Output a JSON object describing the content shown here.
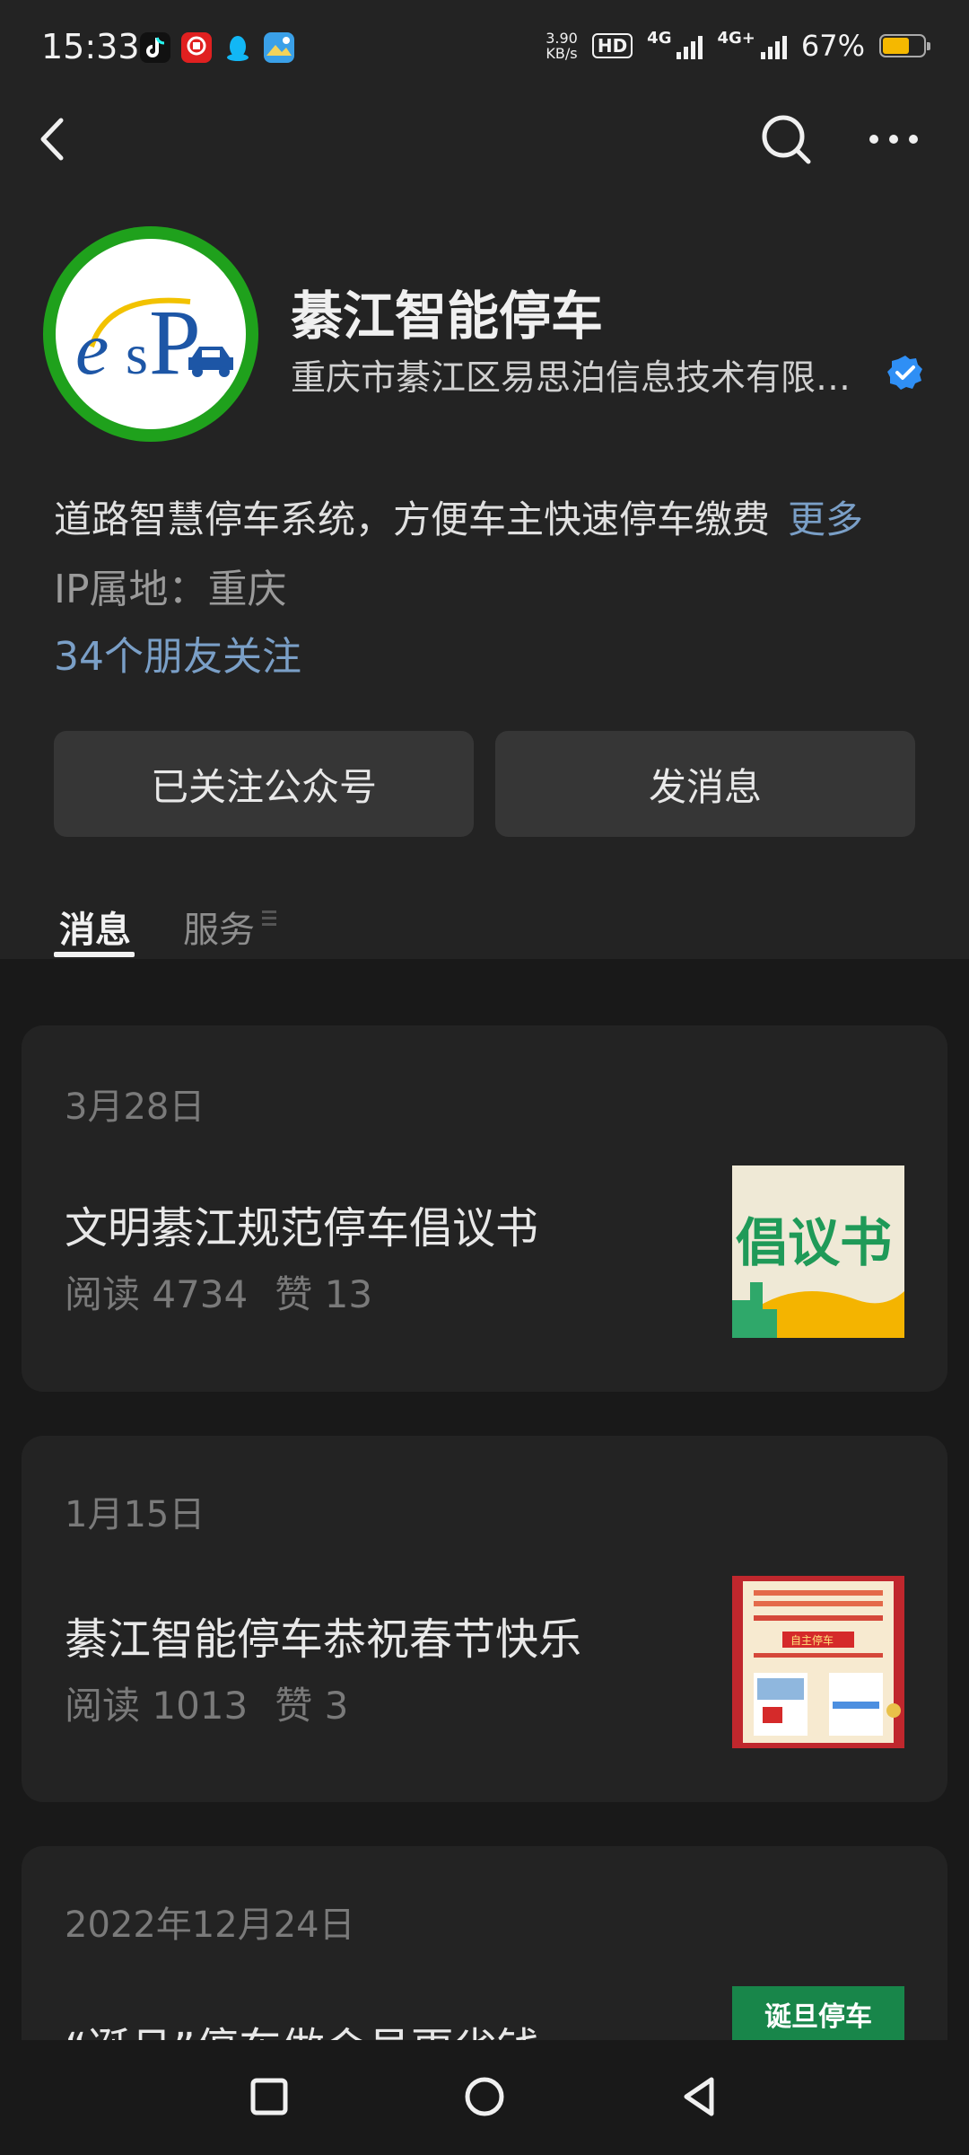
{
  "status_bar": {
    "time": "15:33",
    "net_speed_value": "3.90",
    "net_speed_unit": "KB/s",
    "hd_label": "HD",
    "net_label_1": "4G",
    "net_label_2": "4G+",
    "battery_text": "67%",
    "battery_level": 0.67
  },
  "account": {
    "name": "綦江智能停车",
    "company": "重庆市綦江区易思泊信息技术有限公司",
    "verified": true,
    "logo_letters": [
      "e",
      "s",
      "P"
    ],
    "description": "道路智慧停车系统，方便车主快速停车缴费",
    "more_label": "更多",
    "ip_location": "IP属地：重庆",
    "friends_following": "34个朋友关注"
  },
  "buttons": {
    "following_label": "已关注公众号",
    "message_label": "发消息"
  },
  "tabs": [
    {
      "label": "消息",
      "active": true
    },
    {
      "label": "服务",
      "active": false
    }
  ],
  "articles": [
    {
      "date": "3月28日",
      "title": "文明綦江规范停车倡议书",
      "reads_label": "阅读 4734",
      "likes_label": "赞 13",
      "thumb_text": "倡议书"
    },
    {
      "date": "1月15日",
      "title": "綦江智能停车恭祝春节快乐",
      "reads_label": "阅读 1013",
      "likes_label": "赞 3",
      "thumb_text": "自主停车"
    },
    {
      "date": "2022年12月24日",
      "title": "“诞旦”停车做会员更省钱",
      "reads_label": "",
      "likes_label": "",
      "thumb_text": "诞旦停车"
    }
  ],
  "icons": {
    "back": "chevron-left-icon",
    "search": "search-icon",
    "more": "more-dots-icon",
    "verified": "verified-check-icon",
    "nav_recent": "square-icon",
    "nav_home": "circle-icon",
    "nav_back": "triangle-back-icon"
  },
  "colors": {
    "background": "#191919",
    "header": "#232323",
    "link": "#7a9fc7",
    "verified": "#2f8ff5",
    "logo_ring": "#1fa11c",
    "battery": "#f5b800"
  }
}
